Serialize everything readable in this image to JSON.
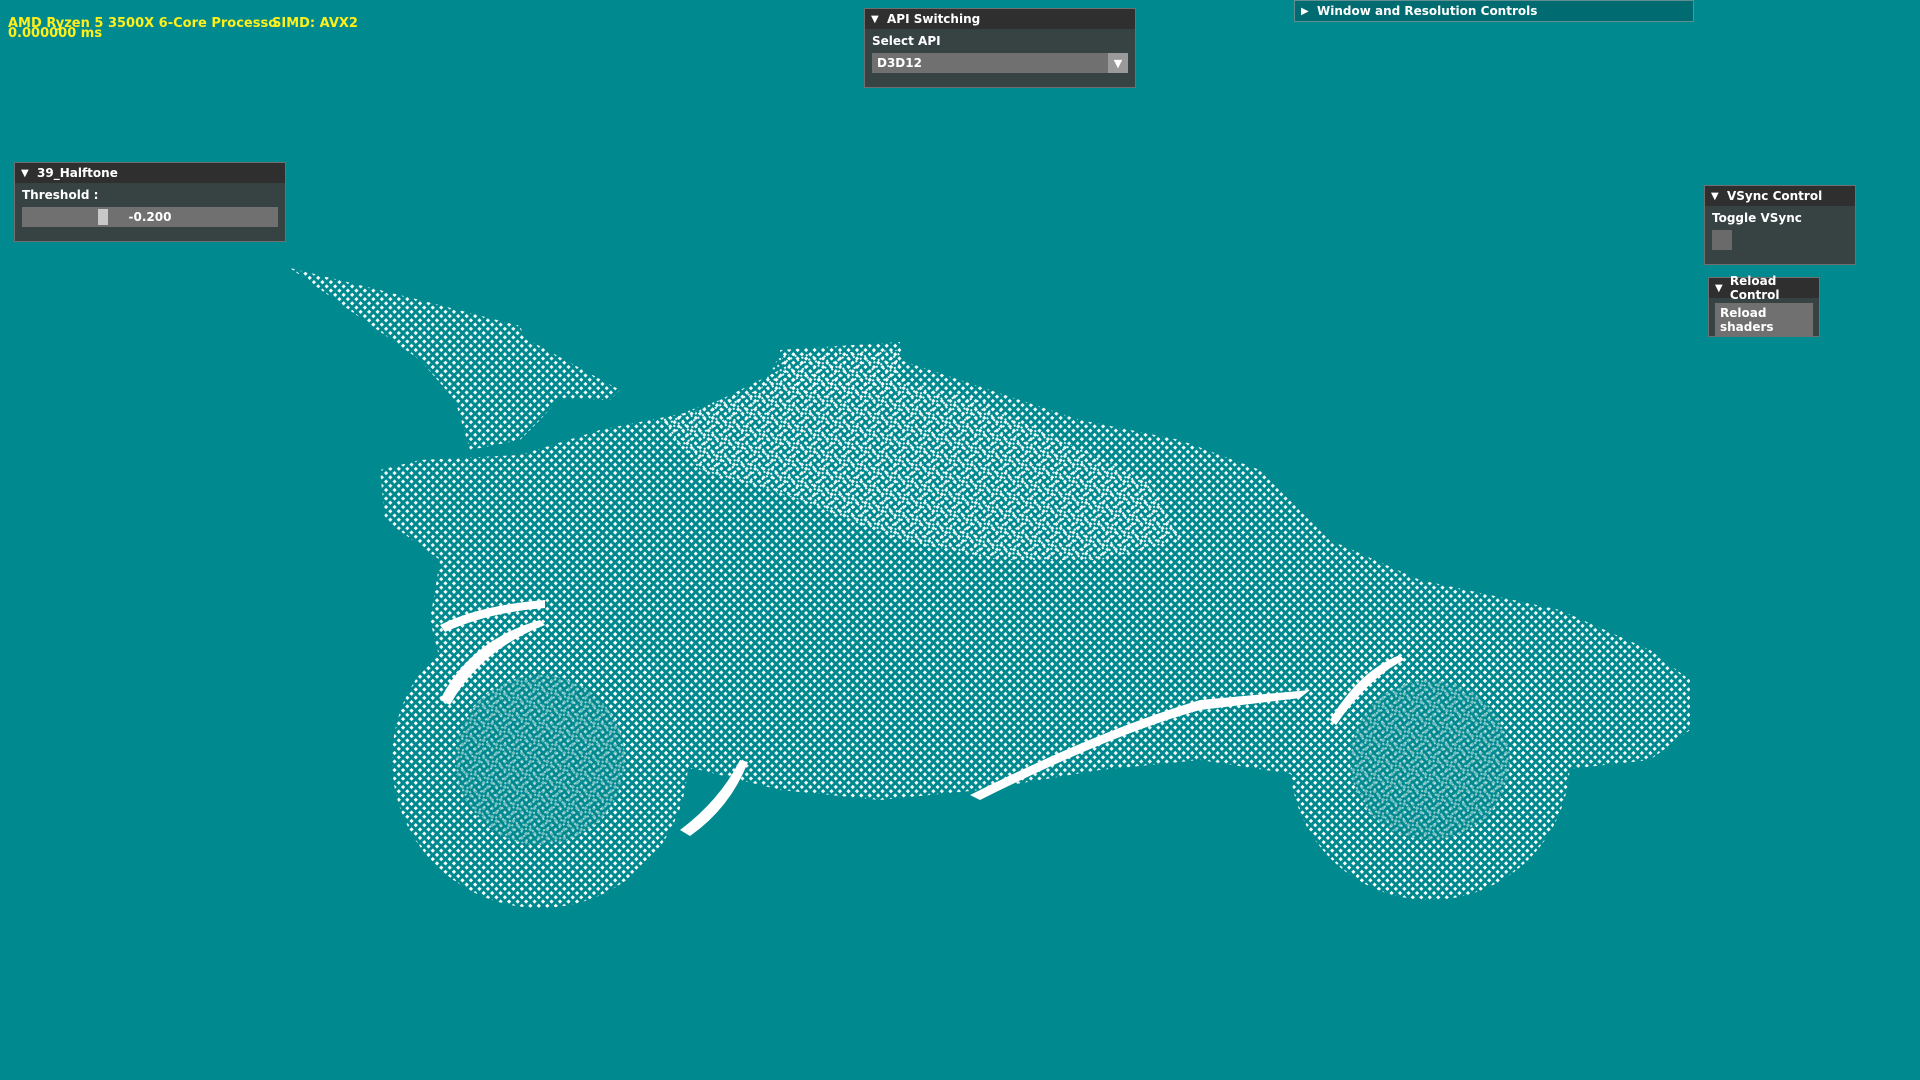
{
  "stats": {
    "cpu": "AMD Ryzen 5 3500X 6-Core Processo",
    "simd": "SIMD: AVX2",
    "frame_time": "0.000000 ms"
  },
  "halftone_panel": {
    "title": "39_Halftone",
    "threshold_label": "Threshold :",
    "threshold_value": "-0.200"
  },
  "api_panel": {
    "title": "API Switching",
    "select_label": "Select API",
    "selected_api": "D3D12"
  },
  "window_panel": {
    "title": "Window and Resolution Controls"
  },
  "vsync_panel": {
    "title": "VSync Control",
    "toggle_label": "Toggle VSync"
  },
  "reload_panel": {
    "title": "Reload Control",
    "button_label": "Reload shaders"
  },
  "colors": {
    "background": "#008a8f",
    "stats_text": "#ffef1a",
    "halftone": "#ffffff"
  },
  "icons": {
    "collapse": "triangle-down-icon",
    "expand": "triangle-right-icon",
    "dropdown": "triangle-down-icon"
  }
}
